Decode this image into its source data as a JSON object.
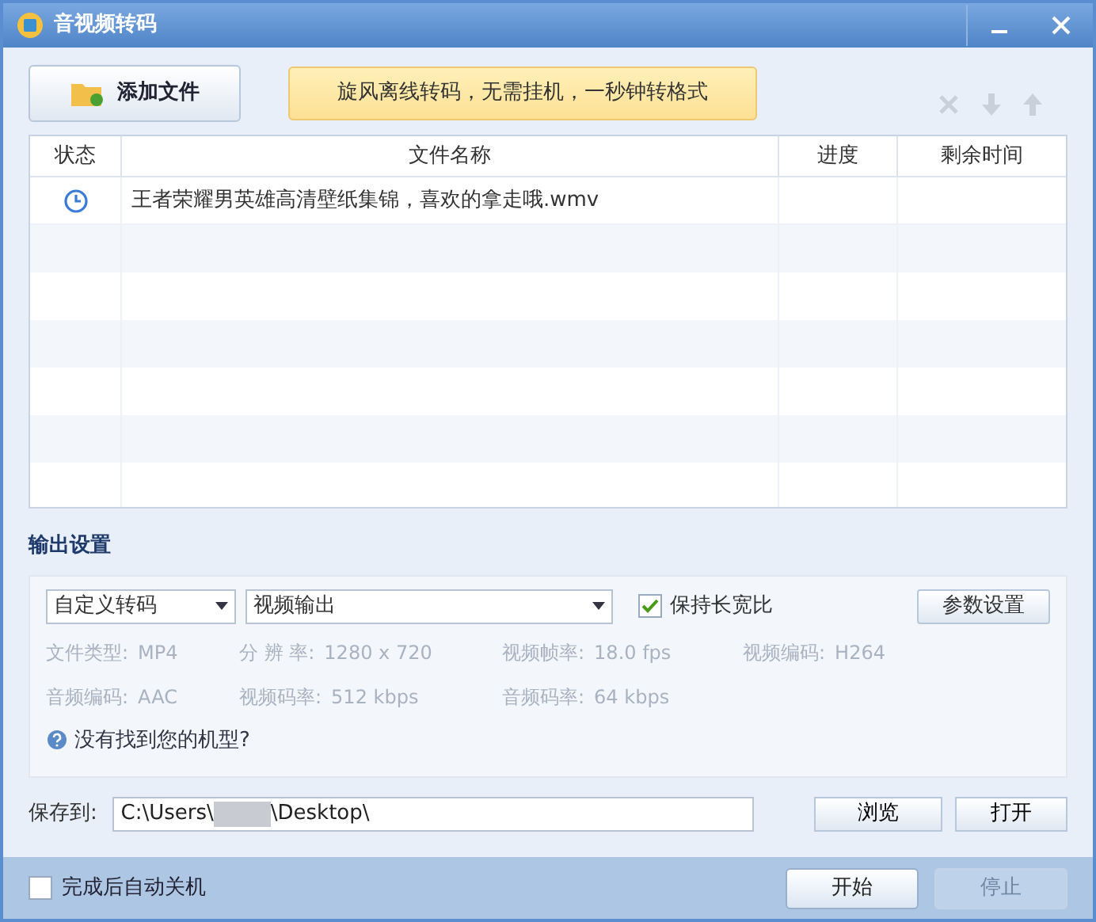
{
  "window": {
    "title": "音视频转码"
  },
  "toolbar": {
    "add_button": "添加文件",
    "banner": "旋风离线转码，无需挂机，一秒钟转格式"
  },
  "table": {
    "columns": [
      "状态",
      "文件名称",
      "进度",
      "剩余时间"
    ],
    "rows": [
      {
        "kind": "waiting",
        "name": "王者荣耀男英雄高清壁纸集锦，喜欢的拿走哦.wmv",
        "progress": "",
        "remaining": ""
      }
    ]
  },
  "output": {
    "title": "输出设置",
    "preset": "自定义转码",
    "mode": "视频输出",
    "keep_ratio": {
      "label": "保持长宽比",
      "checked": true
    },
    "params_button": "参数设置",
    "info": [
      [
        {
          "label": "文件类型:",
          "value": "MP4"
        },
        {
          "label": "分 辨 率:",
          "value": "1280 x 720"
        },
        {
          "label": "视频帧率:",
          "value": "18.0 fps"
        },
        {
          "label": "视频编码:",
          "value": "H264"
        }
      ],
      [
        {
          "label": "音频编码:",
          "value": "AAC"
        },
        {
          "label": "视频码率:",
          "value": "512 kbps"
        },
        {
          "label": "音频码率:",
          "value": "64 kbps"
        }
      ]
    ],
    "help_link": "没有找到您的机型?"
  },
  "save": {
    "label": "保存到:",
    "path_start": "C:\\Users\\",
    "path_end": "\\Desktop\\",
    "browse": "浏览",
    "open": "打开"
  },
  "footer": {
    "shutdown": {
      "label": "完成后自动关机",
      "checked": false
    },
    "start": {
      "label": "开始",
      "disabled": false
    },
    "stop": {
      "label": "停止",
      "disabled": true
    }
  }
}
